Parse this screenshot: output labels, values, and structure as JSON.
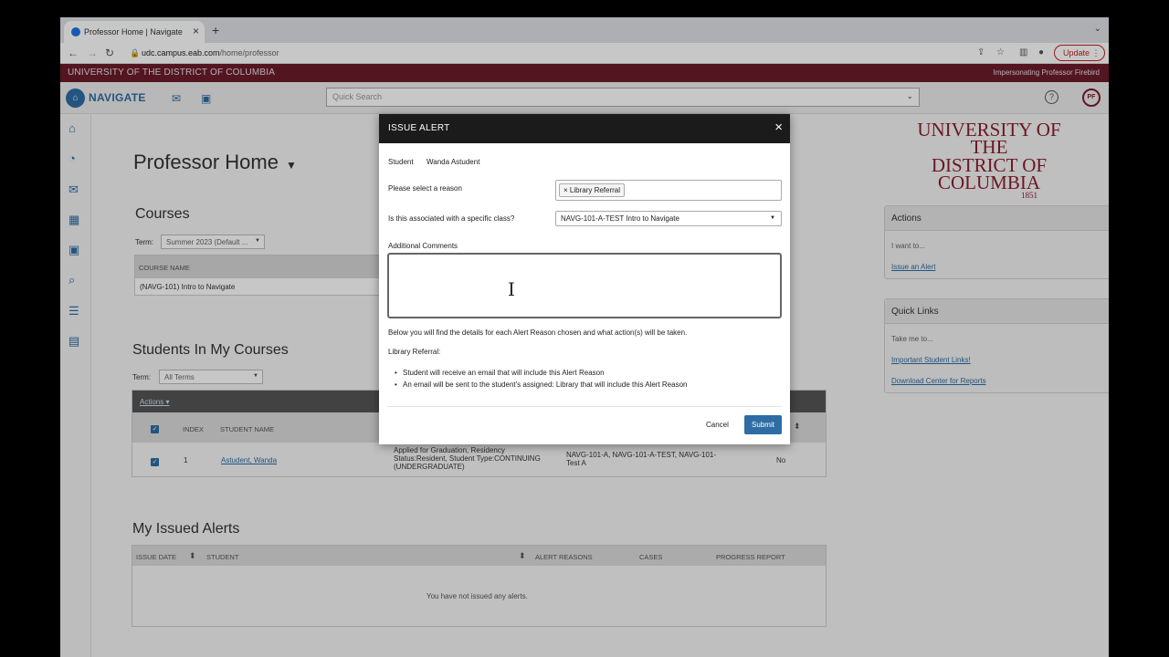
{
  "browser": {
    "tab_title": "Professor Home | Navigate",
    "url_host": "udc.campus.eab.com",
    "url_path": "/home/professor",
    "update_label": "Update"
  },
  "university_bar": {
    "name": "UNIVERSITY OF THE DISTRICT OF COLUMBIA",
    "impersonating": "Impersonating Professor Firebird"
  },
  "app_header": {
    "logo_text": "NAVIGATE",
    "search_placeholder": "Quick Search",
    "avatar_initials": "PF"
  },
  "page": {
    "title": "Professor Home",
    "courses": {
      "heading": "Courses",
      "term_label": "Term:",
      "term_value": "Summer 2023 (Default ...",
      "column": "COURSE NAME",
      "rows": [
        "(NAVG-101) Intro to Navigate"
      ]
    },
    "students": {
      "heading": "Students In My Courses",
      "term_label": "Term:",
      "term_value": "All Terms",
      "actions_label": "Actions",
      "columns": [
        "INDEX",
        "STUDENT NAME"
      ],
      "row": {
        "index": "1",
        "name": "Astudent, Wanda",
        "details": [
          "Applied for Graduation, Residency",
          "Status:Resident, Student Type:CONTINUING",
          "(UNDERGRADUATE)"
        ],
        "classes": [
          "NAVG-101-A, NAVG-101-A-TEST, NAVG-101-",
          "Test A"
        ],
        "flag": "No"
      }
    },
    "alerts": {
      "heading": "My Issued Alerts",
      "columns": [
        "ISSUE DATE",
        "STUDENT",
        "ALERT REASONS",
        "CASES",
        "PROGRESS REPORT"
      ],
      "empty": "You have not issued any alerts."
    }
  },
  "side_panels": {
    "brand": {
      "line1": "UNIVERSITY OF THE",
      "line2": "DISTRICT OF",
      "line3": "COLUMBIA",
      "year": "1851"
    },
    "actions": {
      "title": "Actions",
      "intro": "I want to...",
      "link": "Issue an Alert"
    },
    "quick_links": {
      "title": "Quick Links",
      "intro": "Take me to...",
      "links": [
        "Important Student Links!",
        "Download Center for Reports"
      ]
    }
  },
  "modal": {
    "title": "ISSUE ALERT",
    "student_label": "Student",
    "student_value": "Wanda Astudent",
    "reason_label": "Please select a reason",
    "reason_chip": "Library Referral",
    "class_label": "Is this associated with a specific class?",
    "class_value": "NAVG-101-A-TEST Intro to Navigate",
    "comments_label": "Additional Comments",
    "details_intro": "Below you will find the details for each Alert Reason chosen and what action(s) will be taken.",
    "reason_heading": "Library Referral:",
    "bullets": [
      "Student will receive an email that will include this Alert Reason",
      "An email will be sent to the student's assigned: Library that will include this Alert Reason"
    ],
    "cancel_label": "Cancel",
    "submit_label": "Submit"
  }
}
